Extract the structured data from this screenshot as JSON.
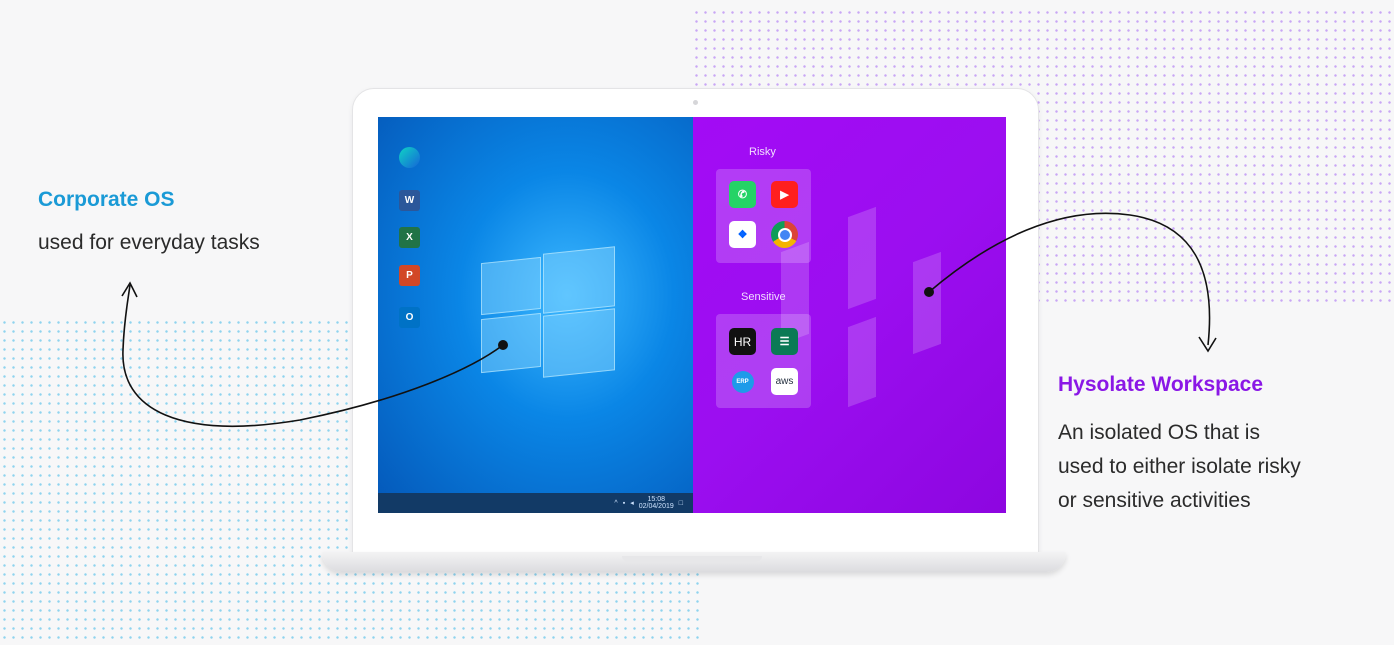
{
  "left_label": {
    "title": "Corporate OS",
    "desc": "used for everyday tasks"
  },
  "right_label": {
    "title": "Hysolate Workspace",
    "desc_lines": [
      "An isolated OS that is",
      "used to either isolate risky",
      "or sensitive activities"
    ]
  },
  "windows_desktop": {
    "icons": [
      "edge-icon",
      "word-icon",
      "excel-icon",
      "powerpoint-icon",
      "outlook-icon"
    ],
    "icon_letters": [
      "",
      "W",
      "X",
      "P",
      "O"
    ],
    "tray_time": "15:08",
    "tray_date": "02/04/2019"
  },
  "hysolate_desktop": {
    "risky_label": "Risky",
    "sensitive_label": "Sensitive",
    "risky_apps": [
      "whatsapp-icon",
      "youtube-icon",
      "dropbox-icon",
      "chrome-icon"
    ],
    "sensitive_apps": [
      "HR",
      "",
      "ERP",
      "aws"
    ]
  },
  "colors": {
    "corporate_accent": "#1a9ad6",
    "hysolate_accent": "#8a17e6"
  }
}
